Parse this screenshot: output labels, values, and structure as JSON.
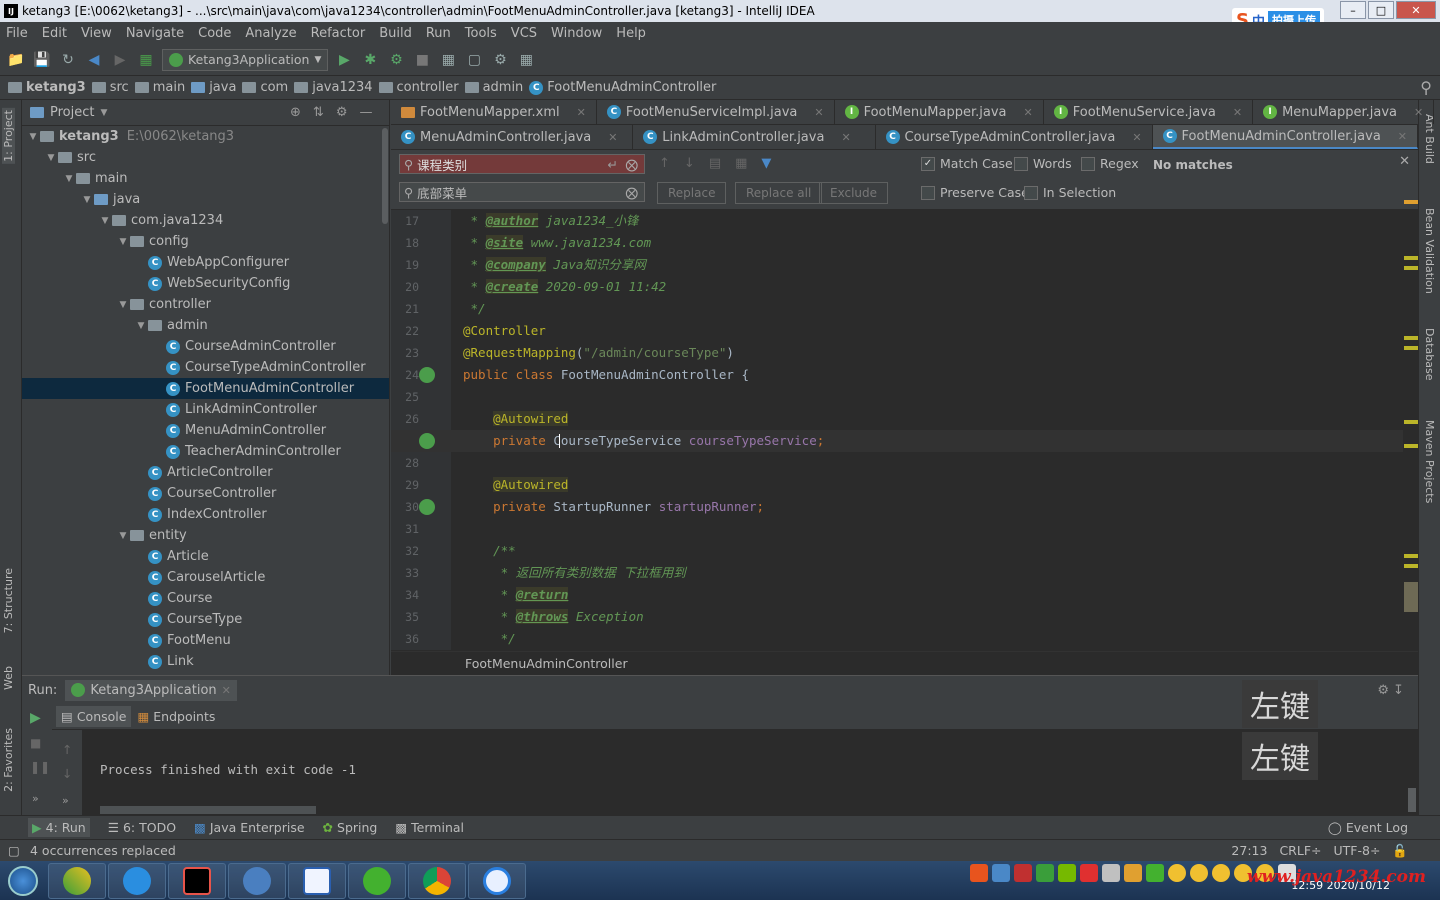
{
  "window": {
    "title": "ketang3 [E:\\0062\\ketang3] - ...\\src\\main\\java\\com\\java1234\\controller\\admin\\FootMenuAdminController.java [ketang3] - IntelliJ IDEA",
    "ime_text": "中",
    "ime_upload": "拍摄上传"
  },
  "menu": [
    "File",
    "Edit",
    "View",
    "Navigate",
    "Code",
    "Analyze",
    "Refactor",
    "Build",
    "Run",
    "Tools",
    "VCS",
    "Window",
    "Help"
  ],
  "run_config": "Ketang3Application",
  "breadcrumbs": [
    "ketang3",
    "src",
    "main",
    "java",
    "com",
    "java1234",
    "controller",
    "admin",
    "FootMenuAdminController"
  ],
  "project_panel": {
    "title": "Project",
    "tree": [
      {
        "label": "ketang3",
        "extra": "E:\\0062\\ketang3",
        "depth": 0,
        "type": "module",
        "open": true
      },
      {
        "label": "src",
        "depth": 1,
        "type": "folder",
        "open": true
      },
      {
        "label": "main",
        "depth": 2,
        "type": "folder",
        "open": true
      },
      {
        "label": "java",
        "depth": 3,
        "type": "folder-blue",
        "open": true
      },
      {
        "label": "com.java1234",
        "depth": 4,
        "type": "package",
        "open": true
      },
      {
        "label": "config",
        "depth": 5,
        "type": "package",
        "open": true
      },
      {
        "label": "WebAppConfigurer",
        "depth": 6,
        "type": "class"
      },
      {
        "label": "WebSecurityConfig",
        "depth": 6,
        "type": "class"
      },
      {
        "label": "controller",
        "depth": 5,
        "type": "package",
        "open": true
      },
      {
        "label": "admin",
        "depth": 6,
        "type": "package",
        "open": true
      },
      {
        "label": "CourseAdminController",
        "depth": 7,
        "type": "class"
      },
      {
        "label": "CourseTypeAdminController",
        "depth": 7,
        "type": "class"
      },
      {
        "label": "FootMenuAdminController",
        "depth": 7,
        "type": "class",
        "selected": true
      },
      {
        "label": "LinkAdminController",
        "depth": 7,
        "type": "class"
      },
      {
        "label": "MenuAdminController",
        "depth": 7,
        "type": "class"
      },
      {
        "label": "TeacherAdminController",
        "depth": 7,
        "type": "class"
      },
      {
        "label": "ArticleController",
        "depth": 6,
        "type": "class"
      },
      {
        "label": "CourseController",
        "depth": 6,
        "type": "class"
      },
      {
        "label": "IndexController",
        "depth": 6,
        "type": "class"
      },
      {
        "label": "entity",
        "depth": 5,
        "type": "package",
        "open": true
      },
      {
        "label": "Article",
        "depth": 6,
        "type": "class"
      },
      {
        "label": "CarouselArticle",
        "depth": 6,
        "type": "class"
      },
      {
        "label": "Course",
        "depth": 6,
        "type": "class"
      },
      {
        "label": "CourseType",
        "depth": 6,
        "type": "class"
      },
      {
        "label": "FootMenu",
        "depth": 6,
        "type": "class"
      },
      {
        "label": "Link",
        "depth": 6,
        "type": "class"
      }
    ]
  },
  "tabs_row1": [
    {
      "label": "FootMenuMapper.xml",
      "icon": "xml"
    },
    {
      "label": "FootMenuServiceImpl.java",
      "icon": "class"
    },
    {
      "label": "FootMenuMapper.java",
      "icon": "iface"
    },
    {
      "label": "FootMenuService.java",
      "icon": "iface"
    },
    {
      "label": "MenuMapper.java",
      "icon": "iface"
    }
  ],
  "tabs_row2": [
    {
      "label": "MenuAdminController.java",
      "icon": "class"
    },
    {
      "label": "LinkAdminController.java",
      "icon": "class"
    },
    {
      "label": "CourseTypeAdminController.java",
      "icon": "class"
    },
    {
      "label": "FootMenuAdminController.java",
      "icon": "class",
      "active": true
    }
  ],
  "find": {
    "search_value": "课程类别",
    "replace_value": "底部菜单",
    "replace_btn": "Replace",
    "replace_all_btn": "Replace all",
    "exclude_btn": "Exclude",
    "match_case": "Match Case",
    "words": "Words",
    "regex": "Regex",
    "preserve_case": "Preserve Case",
    "in_selection": "In Selection",
    "status": "No matches"
  },
  "code_lines": [
    {
      "n": "17"
    },
    {
      "n": "18"
    },
    {
      "n": "19"
    },
    {
      "n": "20"
    },
    {
      "n": "21"
    },
    {
      "n": "22"
    },
    {
      "n": "23"
    },
    {
      "n": "24"
    },
    {
      "n": "25"
    },
    {
      "n": "26"
    },
    {
      "n": "27"
    },
    {
      "n": "28"
    },
    {
      "n": "29"
    },
    {
      "n": "30"
    },
    {
      "n": "31"
    },
    {
      "n": "32"
    },
    {
      "n": "33"
    },
    {
      "n": "34"
    },
    {
      "n": "35"
    },
    {
      "n": "36"
    }
  ],
  "code": {
    "l17_tag": "@author",
    "l17_val": " java1234_小锋",
    "l18_tag": "@site",
    "l18_val": " www.java1234.com",
    "l19_tag": "@company",
    "l19_val": " Java知识分享网",
    "l20_tag": "@create",
    "l20_val": " 2020-09-01 11:42",
    "l21": " */",
    "l22": "@Controller",
    "l23_ann": "@RequestMapping",
    "l23_str": "\"/admin/courseType\"",
    "l24_kw": "public class ",
    "l24_rest": "FootMenuAdminController {",
    "l26": "@Autowired",
    "l27_kw": "private ",
    "l27_type": "CourseTypeService ",
    "l27_fld": "courseTypeService",
    "l29": "@Autowired",
    "l30_kw": "private ",
    "l30_type": "StartupRunner ",
    "l30_fld": "startupRunner",
    "l32": "/**",
    "l33": " * 返回所有类别数据 下拉框用到",
    "l34_tag": "@return",
    "l35_tag": "@throws",
    "l35_val": " Exception",
    "l36": " */"
  },
  "editor_footer": "FootMenuAdminController",
  "run_panel": {
    "label": "Run:",
    "app": "Ketang3Application",
    "console_tab": "Console",
    "endpoints_tab": "Endpoints",
    "output": "Process finished with exit code -1",
    "overlay1": "左键",
    "overlay2": "左键"
  },
  "bottom_tools": [
    "4: Run",
    "6: TODO",
    "Java Enterprise",
    "Spring",
    "Terminal"
  ],
  "event_log": "Event Log",
  "status": {
    "message": "4 occurrences replaced",
    "position": "27:13",
    "line_sep": "CRLF÷",
    "encoding": "UTF-8÷"
  },
  "left_tools": [
    "1: Project",
    "7: Structure",
    "Web",
    "2: Favorites"
  ],
  "right_tools": [
    "Ant Build",
    "Bean Validation",
    "Database",
    "Maven Projects"
  ],
  "taskbar": {
    "watermark": "www.java1234.com",
    "time": "12:59",
    "date": "2020/10/12"
  },
  "colors": {
    "accent": "#4a88c7",
    "selection": "#0d293e",
    "annotation": "#bbb529",
    "keyword": "#cc7832",
    "comment": "#629755"
  }
}
